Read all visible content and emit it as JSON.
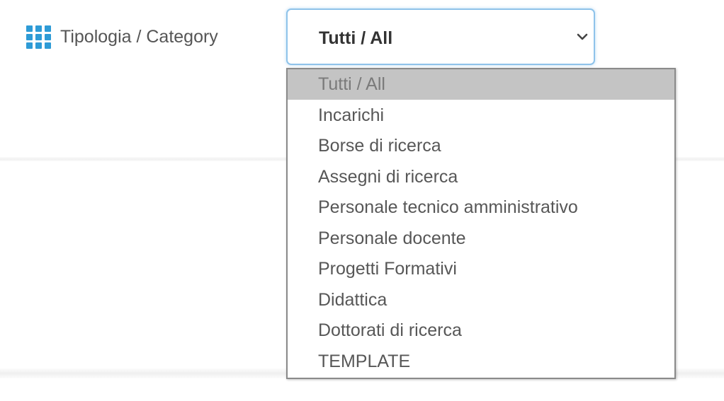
{
  "filter": {
    "label": "Tipologia / Category",
    "icon": "grid-icon",
    "accent_color": "#2e9bd6",
    "select": {
      "value": "Tutti / All",
      "arrow_icon": "chevron-down-icon"
    }
  },
  "dropdown": {
    "selected_index": 0,
    "options": [
      "Tutti / All",
      "Incarichi",
      "Borse di ricerca",
      "Assegni di ricerca",
      "Personale tecnico amministrativo",
      "Personale docente",
      "Progetti Formativi",
      "Didattica",
      "Dottorati di ricerca",
      "TEMPLATE"
    ]
  }
}
